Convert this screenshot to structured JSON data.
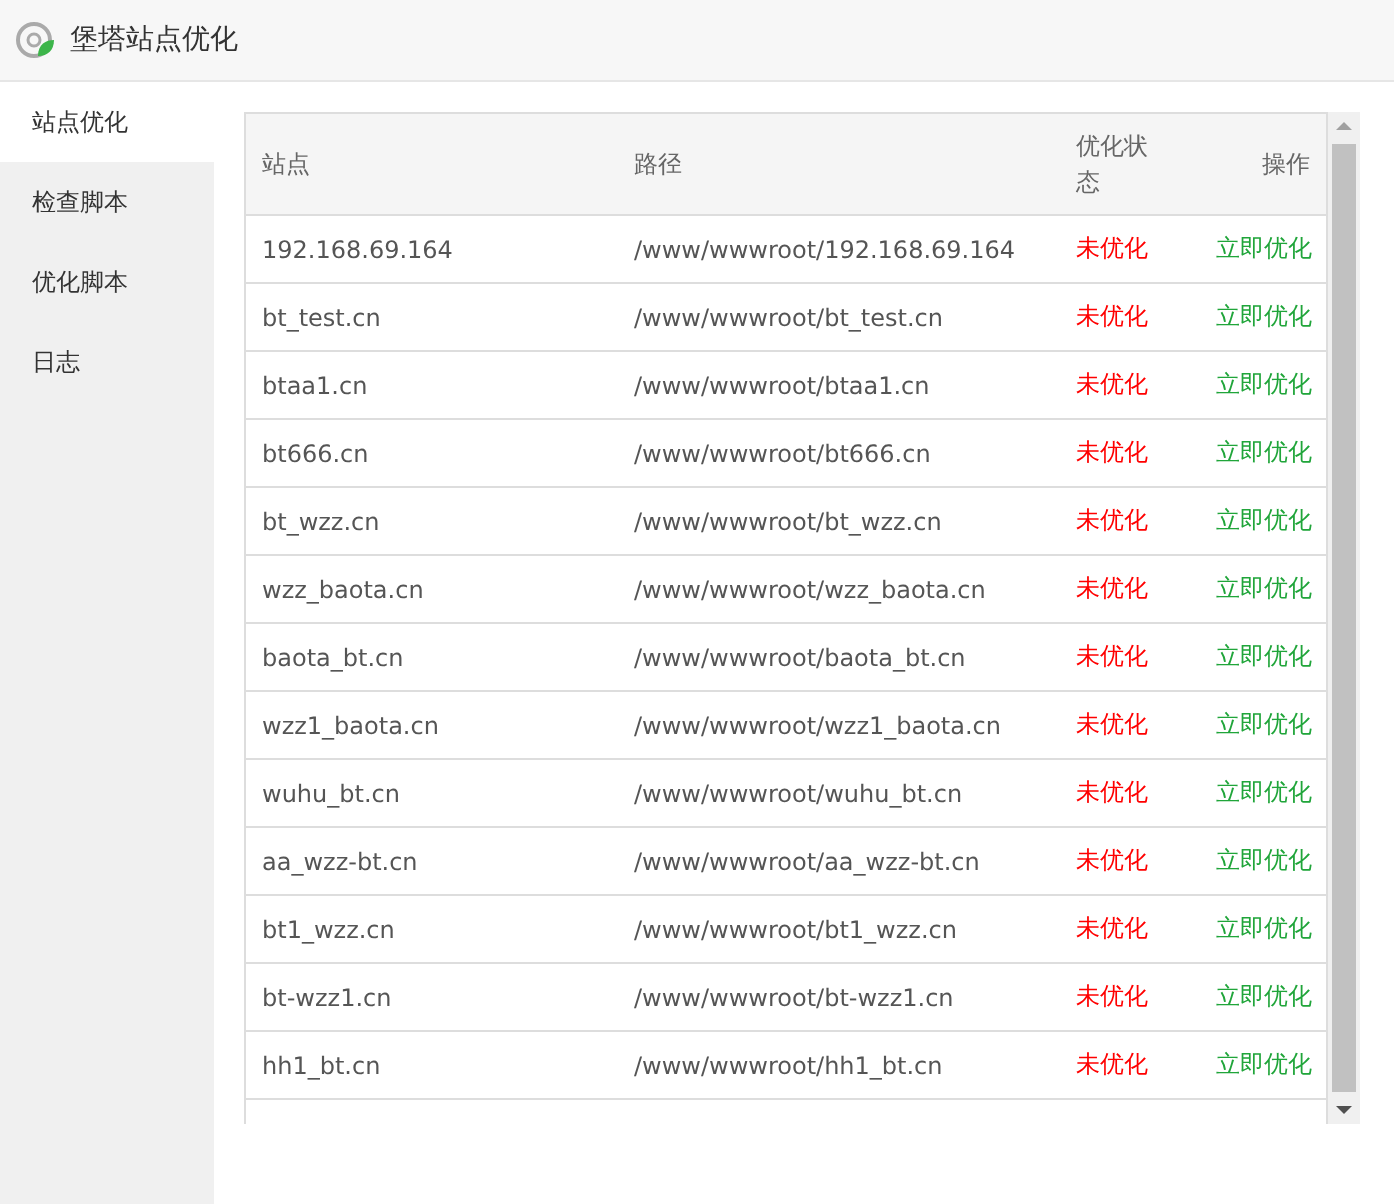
{
  "window": {
    "title": "堡塔站点优化"
  },
  "sidebar": {
    "items": [
      {
        "label": "站点优化",
        "selected": true
      },
      {
        "label": "检查脚本",
        "selected": false
      },
      {
        "label": "优化脚本",
        "selected": false
      },
      {
        "label": "日志",
        "selected": false
      }
    ]
  },
  "table": {
    "columns": [
      "站点",
      "路径",
      "优化状态",
      "操作"
    ],
    "rows": [
      {
        "site": "192.168.69.164",
        "path": "/www/wwwroot/192.168.69.164",
        "status": "未优化",
        "optimized": false,
        "action": "立即优化"
      },
      {
        "site": "bt_test.cn",
        "path": "/www/wwwroot/bt_test.cn",
        "status": "未优化",
        "optimized": false,
        "action": "立即优化"
      },
      {
        "site": "btaa1.cn",
        "path": "/www/wwwroot/btaa1.cn",
        "status": "未优化",
        "optimized": false,
        "action": "立即优化"
      },
      {
        "site": "bt666.cn",
        "path": "/www/wwwroot/bt666.cn",
        "status": "未优化",
        "optimized": false,
        "action": "立即优化"
      },
      {
        "site": "bt_wzz.cn",
        "path": "/www/wwwroot/bt_wzz.cn",
        "status": "未优化",
        "optimized": false,
        "action": "立即优化"
      },
      {
        "site": "wzz_baota.cn",
        "path": "/www/wwwroot/wzz_baota.cn",
        "status": "未优化",
        "optimized": false,
        "action": "立即优化"
      },
      {
        "site": "baota_bt.cn",
        "path": "/www/wwwroot/baota_bt.cn",
        "status": "未优化",
        "optimized": false,
        "action": "立即优化"
      },
      {
        "site": "wzz1_baota.cn",
        "path": "/www/wwwroot/wzz1_baota.cn",
        "status": "未优化",
        "optimized": false,
        "action": "立即优化"
      },
      {
        "site": "wuhu_bt.cn",
        "path": "/www/wwwroot/wuhu_bt.cn",
        "status": "未优化",
        "optimized": false,
        "action": "立即优化"
      },
      {
        "site": "aa_wzz-bt.cn",
        "path": "/www/wwwroot/aa_wzz-bt.cn",
        "status": "未优化",
        "optimized": false,
        "action": "立即优化"
      },
      {
        "site": "bt1_wzz.cn",
        "path": "/www/wwwroot/bt1_wzz.cn",
        "status": "未优化",
        "optimized": false,
        "action": "立即优化"
      },
      {
        "site": "bt-wzz1.cn",
        "path": "/www/wwwroot/bt-wzz1.cn",
        "status": "未优化",
        "optimized": false,
        "action": "立即优化"
      },
      {
        "site": "hh1_bt.cn",
        "path": "/www/wwwroot/hh1_bt.cn",
        "status": "未优化",
        "optimized": false,
        "action": "立即优化"
      }
    ]
  }
}
